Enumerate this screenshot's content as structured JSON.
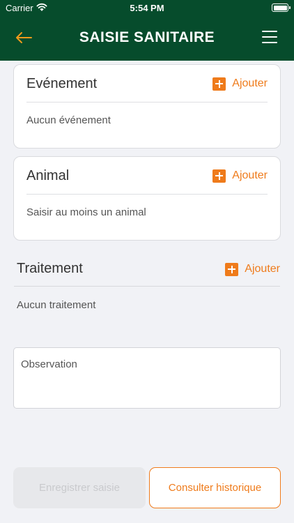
{
  "status_bar": {
    "carrier": "Carrier",
    "time": "5:54 PM"
  },
  "nav": {
    "title": "SAISIE SANITAIRE",
    "back_icon": "arrow-left-icon",
    "menu_icon": "hamburger-menu-icon"
  },
  "sections": {
    "evenement": {
      "title": "Evénement",
      "add_label": "Ajouter",
      "empty_text": "Aucun événement"
    },
    "animal": {
      "title": "Animal",
      "add_label": "Ajouter",
      "empty_text": "Saisir au moins un animal"
    },
    "traitement": {
      "title": "Traitement",
      "add_label": "Ajouter",
      "empty_text": "Aucun traitement"
    }
  },
  "observation": {
    "placeholder": "Observation"
  },
  "buttons": {
    "save": "Enregistrer saisie",
    "history": "Consulter historique"
  },
  "colors": {
    "primary": "#064c2c",
    "accent": "#ef7b1b",
    "background": "#f1f2f6"
  }
}
